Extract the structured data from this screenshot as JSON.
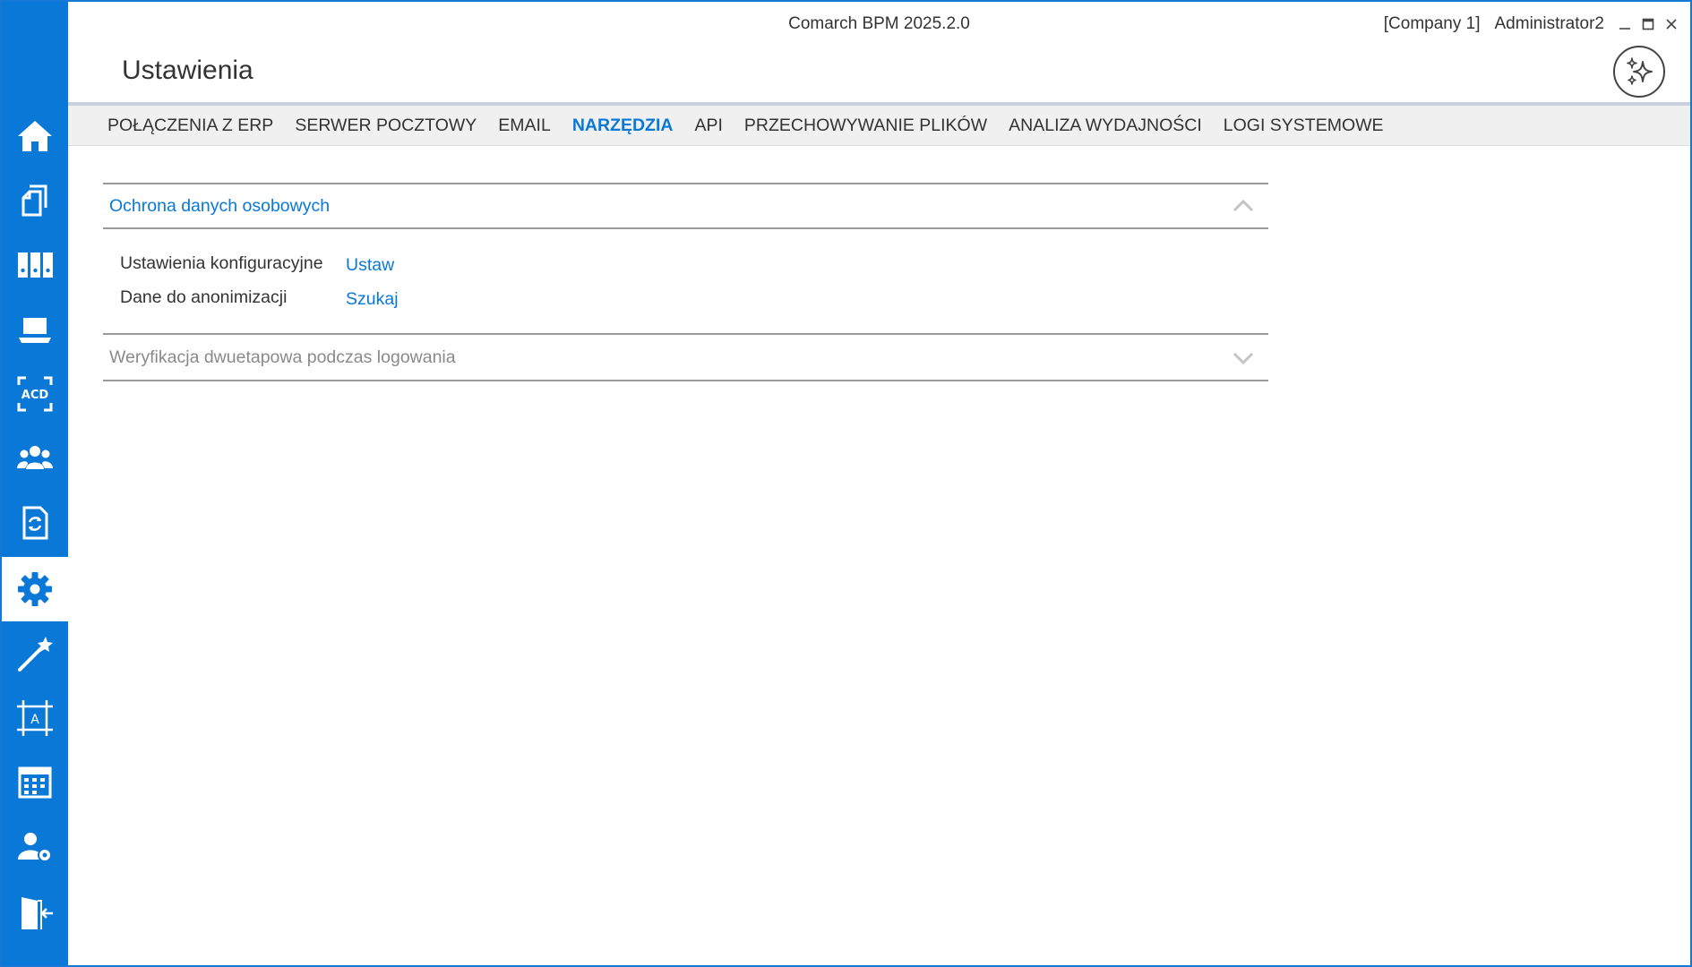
{
  "app": {
    "title": "Comarch BPM 2025.2.0",
    "company": "[Company 1]",
    "user": "Administrator2"
  },
  "window_controls": [
    "minimize-icon",
    "maximize-icon",
    "close-icon"
  ],
  "page": {
    "title": "Ustawienia"
  },
  "sidebar": {
    "items": [
      {
        "icon": "home-icon",
        "active": false
      },
      {
        "icon": "documents-icon",
        "active": false
      },
      {
        "icon": "binders-icon",
        "active": false
      },
      {
        "icon": "laptop-icon",
        "active": false
      },
      {
        "icon": "acd-scan-icon",
        "active": false
      },
      {
        "icon": "users-group-icon",
        "active": false
      },
      {
        "icon": "document-sync-icon",
        "active": false
      },
      {
        "icon": "gear-icon",
        "active": true
      },
      {
        "icon": "magic-wand-icon",
        "active": false
      },
      {
        "icon": "designer-frame-icon",
        "active": false
      },
      {
        "icon": "calendar-icon",
        "active": false
      },
      {
        "icon": "user-settings-icon",
        "active": false
      },
      {
        "icon": "exit-door-icon",
        "active": false
      }
    ]
  },
  "tabs": [
    {
      "label": "POŁĄCZENIA Z ERP",
      "active": false
    },
    {
      "label": "SERWER POCZTOWY",
      "active": false
    },
    {
      "label": "EMAIL",
      "active": false
    },
    {
      "label": "NARZĘDZIA",
      "active": true
    },
    {
      "label": "API",
      "active": false
    },
    {
      "label": "PRZECHOWYWANIE PLIKÓW",
      "active": false
    },
    {
      "label": "ANALIZA WYDAJNOŚCI",
      "active": false
    },
    {
      "label": "LOGI SYSTEMOWE",
      "active": false
    }
  ],
  "sections": [
    {
      "title": "Ochrona danych osobowych",
      "expanded": true,
      "rows": [
        {
          "label": "Ustawienia konfiguracyjne",
          "action": "Ustaw"
        },
        {
          "label": "Dane do anonimizacji",
          "action": "Szukaj"
        }
      ]
    },
    {
      "title": "Weryfikacja dwuetapowa podczas logowania",
      "expanded": false
    }
  ],
  "colors": {
    "accent": "#0a78d7",
    "sidebar": "#0a78d7",
    "muted_text": "#8a8a8a"
  }
}
